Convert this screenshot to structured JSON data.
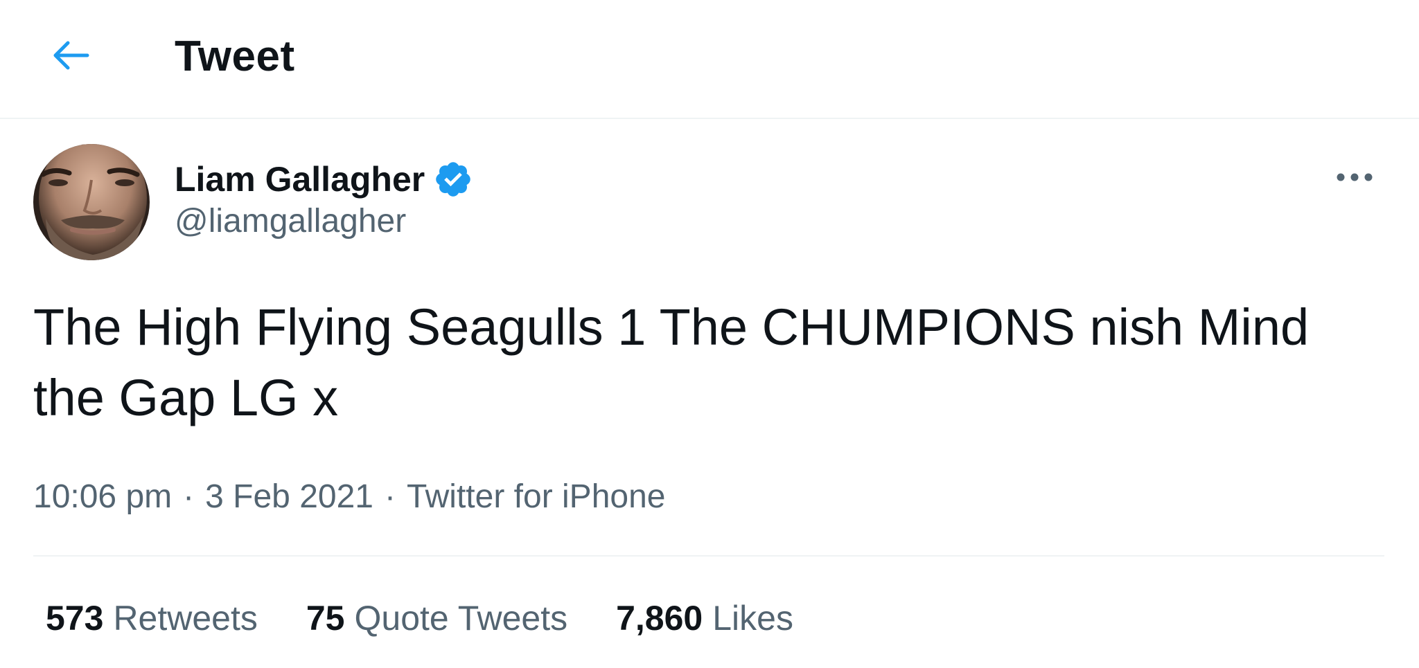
{
  "header": {
    "title": "Tweet",
    "back_icon": "arrow-left-icon",
    "accent": "#1d9bf0"
  },
  "tweet": {
    "author": {
      "display_name": "Liam Gallagher",
      "handle": "@liamgallagher",
      "verified": true,
      "verified_icon": "verified-badge-icon"
    },
    "more_icon": "more-horizontal-icon",
    "text": "The High Flying Seagulls 1 The CHUMPIONS nish Mind the Gap LG x",
    "time": "10:06 pm",
    "date": "3 Feb 2021",
    "source": "Twitter for iPhone",
    "separator": "·"
  },
  "stats": [
    {
      "count": "573",
      "label": "Retweets"
    },
    {
      "count": "75",
      "label": "Quote Tweets"
    },
    {
      "count": "7,860",
      "label": "Likes"
    }
  ]
}
